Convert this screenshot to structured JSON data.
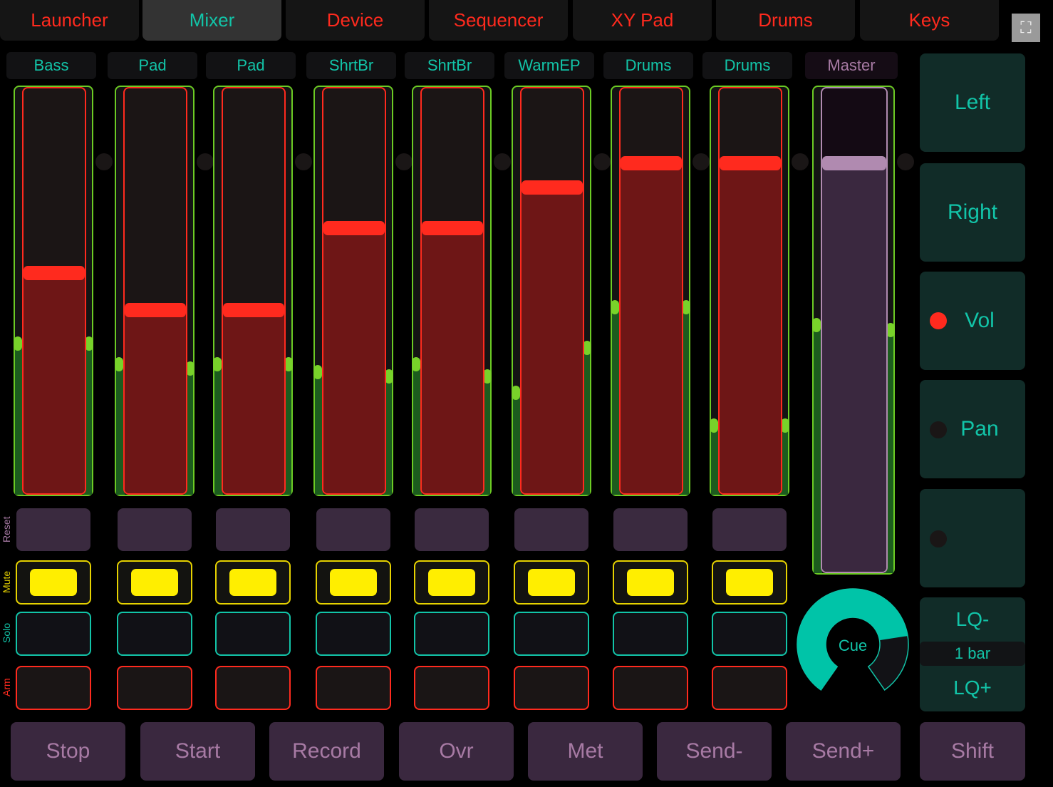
{
  "tabs": [
    {
      "label": "Launcher",
      "active": false
    },
    {
      "label": "Mixer",
      "active": true
    },
    {
      "label": "Device",
      "active": false
    },
    {
      "label": "Sequencer",
      "active": false
    },
    {
      "label": "XY Pad",
      "active": false
    },
    {
      "label": "Drums",
      "active": false
    },
    {
      "label": "Keys",
      "active": false
    }
  ],
  "fullscreen_icon": "expand-icon",
  "tracks": [
    {
      "name": "Bass",
      "volume": 0.54,
      "meter_l": 0.37,
      "meter_r": 0.37,
      "mute": true,
      "solo": false,
      "arm": false
    },
    {
      "name": "Pad",
      "volume": 0.45,
      "meter_l": 0.32,
      "meter_r": 0.31,
      "mute": true,
      "solo": false,
      "arm": false
    },
    {
      "name": "Pad",
      "volume": 0.45,
      "meter_l": 0.32,
      "meter_r": 0.32,
      "mute": true,
      "solo": false,
      "arm": false
    },
    {
      "name": "ShrtBr",
      "volume": 0.65,
      "meter_l": 0.3,
      "meter_r": 0.29,
      "mute": true,
      "solo": false,
      "arm": false
    },
    {
      "name": "ShrtBr",
      "volume": 0.65,
      "meter_l": 0.32,
      "meter_r": 0.29,
      "mute": true,
      "solo": false,
      "arm": false
    },
    {
      "name": "WarmEP",
      "volume": 0.75,
      "meter_l": 0.25,
      "meter_r": 0.36,
      "mute": true,
      "solo": false,
      "arm": false
    },
    {
      "name": "Drums",
      "volume": 0.81,
      "meter_l": 0.46,
      "meter_r": 0.46,
      "mute": true,
      "solo": false,
      "arm": false
    },
    {
      "name": "Drums",
      "volume": 0.81,
      "meter_l": 0.17,
      "meter_r": 0.17,
      "mute": true,
      "solo": false,
      "arm": false
    }
  ],
  "master": {
    "name": "Master",
    "volume": 0.84,
    "meter_l": 0.51,
    "meter_r": 0.5
  },
  "row_labels": {
    "reset": "Reset",
    "mute": "Mute",
    "solo": "Solo",
    "arm": "Arm"
  },
  "side": {
    "left": "Left",
    "right": "Right",
    "vol": "Vol",
    "pan": "Pan",
    "vol_active": true,
    "pan_active": false,
    "lq_minus": "LQ-",
    "lq_value": "1 bar",
    "lq_plus": "LQ+"
  },
  "cue": {
    "label": "Cue",
    "value": 0.78
  },
  "bottom": [
    "Stop",
    "Start",
    "Record",
    "Ovr",
    "Met",
    "Send-",
    "Send+",
    "Shift"
  ],
  "colors": {
    "accent": "#12c4a8",
    "red": "#ff2a1e",
    "yellow": "#ffee00",
    "green": "#78d22a",
    "purple": "#a77aa4"
  }
}
